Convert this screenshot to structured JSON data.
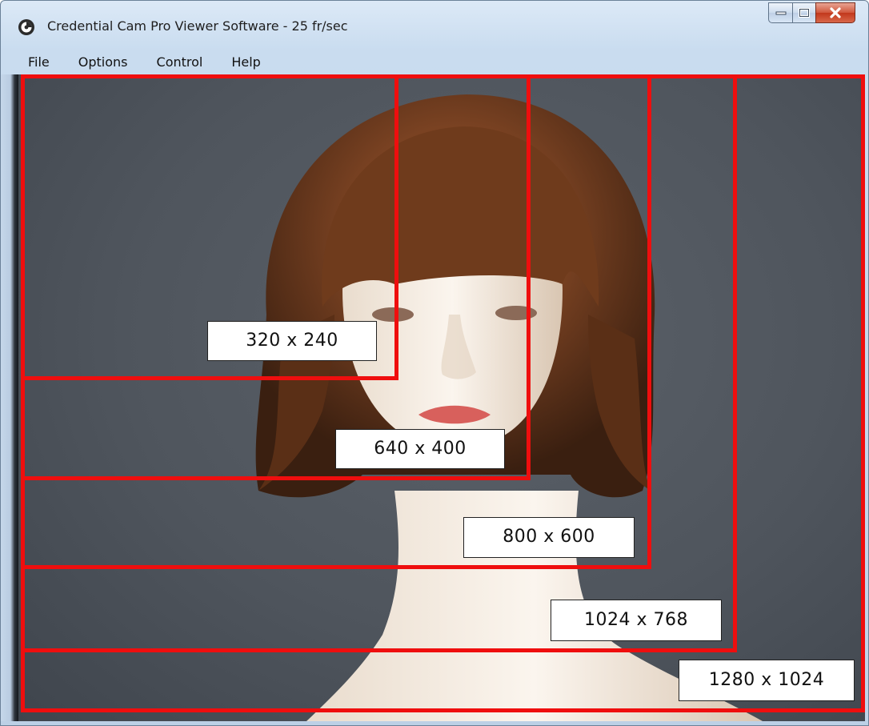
{
  "window": {
    "title": "Credential Cam Pro Viewer Software - 25 fr/sec",
    "controls": {
      "minimize": "minimize",
      "maximize": "maximize",
      "close": "close"
    }
  },
  "menu": {
    "file": "File",
    "options": "Options",
    "control": "Control",
    "help": "Help"
  },
  "resolutions": [
    {
      "label": "320 x 240"
    },
    {
      "label": "640 x 400"
    },
    {
      "label": "800 x 600"
    },
    {
      "label": "1024 x 768"
    },
    {
      "label": "1280 x 1024"
    }
  ],
  "colors": {
    "overlay_border": "#ef0e0e",
    "background": "#4f555d",
    "hair": "#6b3a1c",
    "skin": "#f1e7dc"
  },
  "icons": {
    "app": "camera-lens-icon",
    "minimize": "minimize-icon",
    "maximize": "maximize-icon",
    "close": "close-icon"
  }
}
